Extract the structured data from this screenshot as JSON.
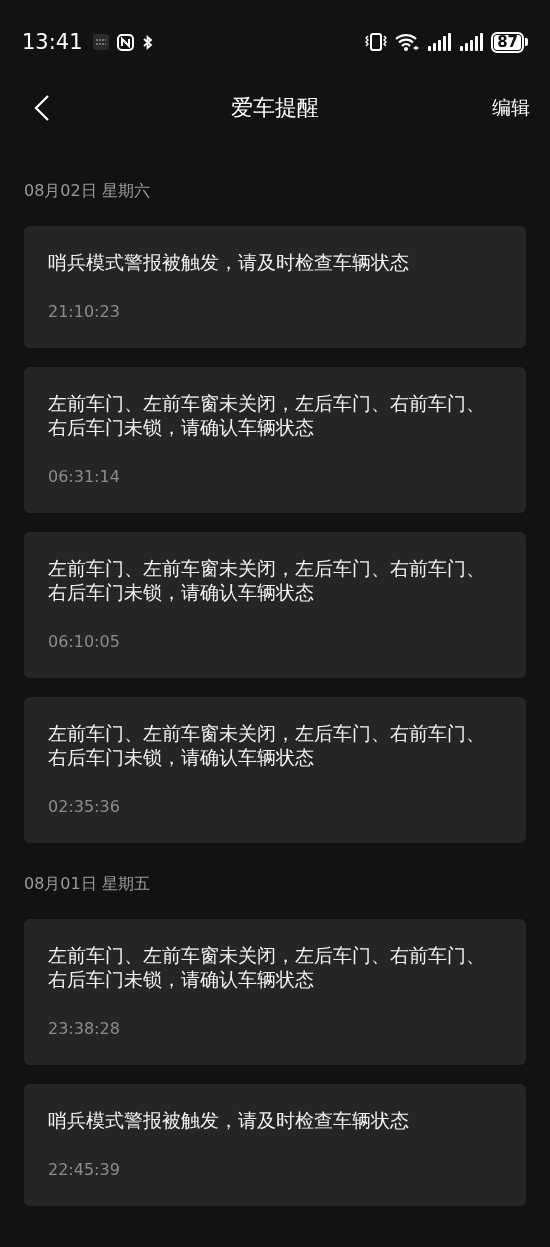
{
  "status_bar": {
    "time": "13:41",
    "battery": "87"
  },
  "header": {
    "title": "爱车提醒",
    "action": "编辑"
  },
  "groups": [
    {
      "date": "08月02日 星期六",
      "items": [
        {
          "message": "哨兵模式警报被触发，请及时检查车辆状态",
          "time": "21:10:23"
        },
        {
          "message": "左前车门、左前车窗未关闭，左后车门、右前车门、右后车门未锁，请确认车辆状态",
          "time": "06:31:14"
        },
        {
          "message": "左前车门、左前车窗未关闭，左后车门、右前车门、右后车门未锁，请确认车辆状态",
          "time": "06:10:05"
        },
        {
          "message": "左前车门、左前车窗未关闭，左后车门、右前车门、右后车门未锁，请确认车辆状态",
          "time": "02:35:36"
        }
      ]
    },
    {
      "date": "08月01日 星期五",
      "items": [
        {
          "message": "左前车门、左前车窗未关闭，左后车门、右前车门、右后车门未锁，请确认车辆状态",
          "time": "23:38:28"
        },
        {
          "message": "哨兵模式警报被触发，请及时检查车辆状态",
          "time": "22:45:39"
        }
      ]
    }
  ]
}
